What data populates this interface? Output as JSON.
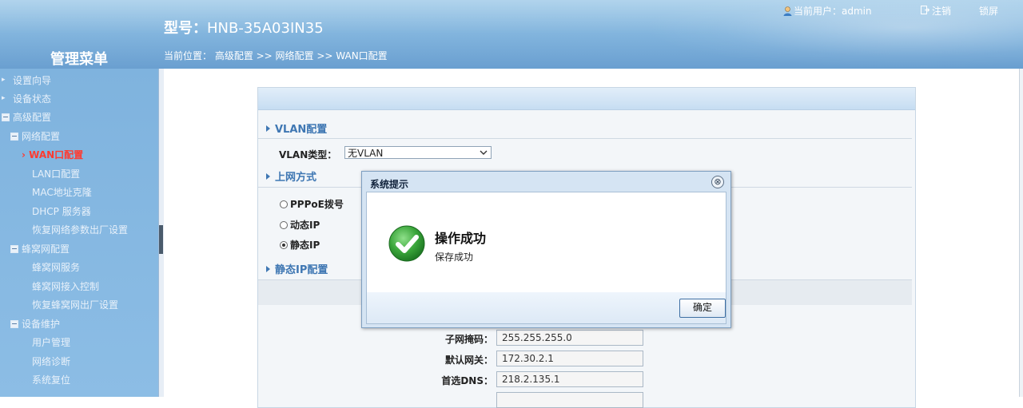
{
  "header": {
    "model_label": "型号：",
    "model_value": "HNB-35A03IN35",
    "current_user": "当前用户：admin",
    "logout": "注销",
    "lock": "锁屏",
    "menu_title": "管理菜单",
    "breadcrumb": "当前位置： 高级配置 >> 网络配置 >> WAN口配置"
  },
  "sidebar": {
    "items": [
      {
        "label": "设置向导"
      },
      {
        "label": "设备状态"
      },
      {
        "label": "高级配置"
      },
      {
        "label": "网络配置"
      },
      {
        "label": "WAN口配置"
      },
      {
        "label": "LAN口配置"
      },
      {
        "label": "MAC地址克隆"
      },
      {
        "label": "DHCP 服务器"
      },
      {
        "label": "恢复网络参数出厂设置"
      },
      {
        "label": "蜂窝网配置"
      },
      {
        "label": "蜂窝网服务"
      },
      {
        "label": "蜂窝网接入控制"
      },
      {
        "label": "恢复蜂窝网出厂设置"
      },
      {
        "label": "设备维护"
      },
      {
        "label": "用户管理"
      },
      {
        "label": "网络诊断"
      },
      {
        "label": "系统复位"
      }
    ]
  },
  "form": {
    "vlan_section": "VLAN配置",
    "vlan_type_label": "VLAN类型：",
    "vlan_type_value": "无VLAN",
    "internet_section": "上网方式",
    "radio_pppoe": "PPPoE拨号",
    "radio_dynamic": "动态IP",
    "radio_static": "静态IP",
    "static_section": "静态IP配置",
    "subnet_label": "子网掩码：",
    "subnet_value": "255.255.255.0",
    "gateway_label": "默认网关：",
    "gateway_value": "172.30.2.1",
    "dns_label": "首选DNS：",
    "dns_value": "218.2.135.1"
  },
  "dialog": {
    "title": "系统提示",
    "close": "⊗",
    "heading": "操作成功",
    "message": "保存成功",
    "ok": "确定"
  },
  "colors": {
    "header_blue": "#7fb2dc",
    "sidebar_blue": "#8cbde5",
    "active_red": "#ff3b30",
    "section_blue": "#3f77b3",
    "success_green": "#3aa53a"
  }
}
